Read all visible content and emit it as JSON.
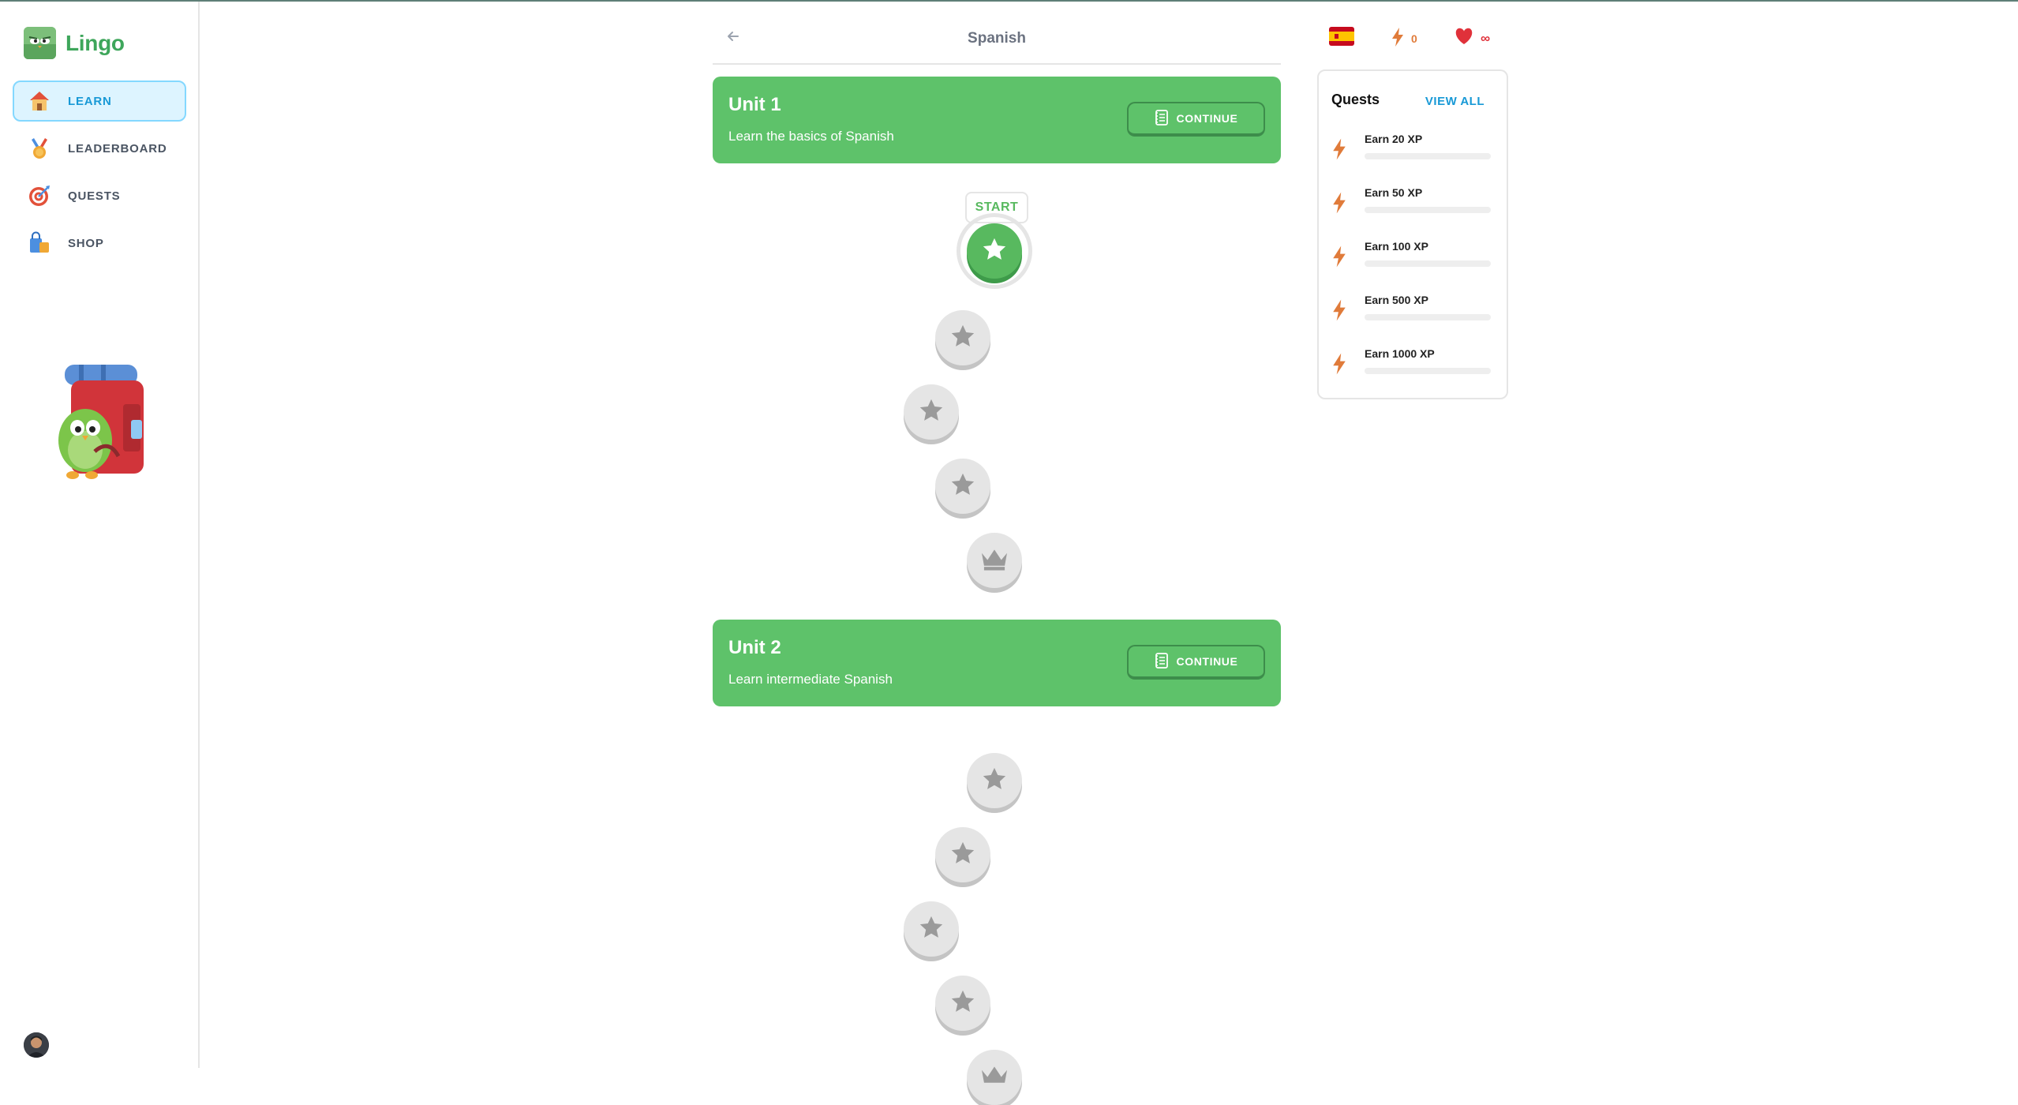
{
  "app": {
    "name": "Lingo"
  },
  "sidebar": {
    "items": [
      {
        "label": "LEARN",
        "icon": "house-icon",
        "active": true
      },
      {
        "label": "LEADERBOARD",
        "icon": "medal-icon",
        "active": false
      },
      {
        "label": "QUESTS",
        "icon": "target-icon",
        "active": false
      },
      {
        "label": "SHOP",
        "icon": "shopping-bag-icon",
        "active": false
      }
    ]
  },
  "header": {
    "title": "Spanish",
    "back_icon": "arrow-left-icon"
  },
  "units": [
    {
      "title": "Unit 1",
      "description": "Learn the basics of Spanish",
      "button_label": "CONTINUE",
      "button_icon": "notebook-icon"
    },
    {
      "title": "Unit 2",
      "description": "Learn intermediate Spanish",
      "button_label": "CONTINUE",
      "button_icon": "notebook-icon"
    }
  ],
  "path": {
    "start_label": "START"
  },
  "stats": {
    "flag": "spain-flag-icon",
    "xp_icon": "lightning-icon",
    "xp_value": "0",
    "hearts_icon": "heart-icon",
    "hearts_value": "∞"
  },
  "quests": {
    "title": "Quests",
    "view_all": "VIEW ALL",
    "items": [
      {
        "label": "Earn 20 XP",
        "progress": 0
      },
      {
        "label": "Earn 50 XP",
        "progress": 0
      },
      {
        "label": "Earn 100 XP",
        "progress": 0
      },
      {
        "label": "Earn 500 XP",
        "progress": 0
      },
      {
        "label": "Earn 1000 XP",
        "progress": 0
      }
    ]
  },
  "colors": {
    "brand_green": "#58b95f",
    "accent_blue": "#1899d6",
    "xp_orange": "#e07b3a",
    "heart_red": "#e0313a"
  }
}
